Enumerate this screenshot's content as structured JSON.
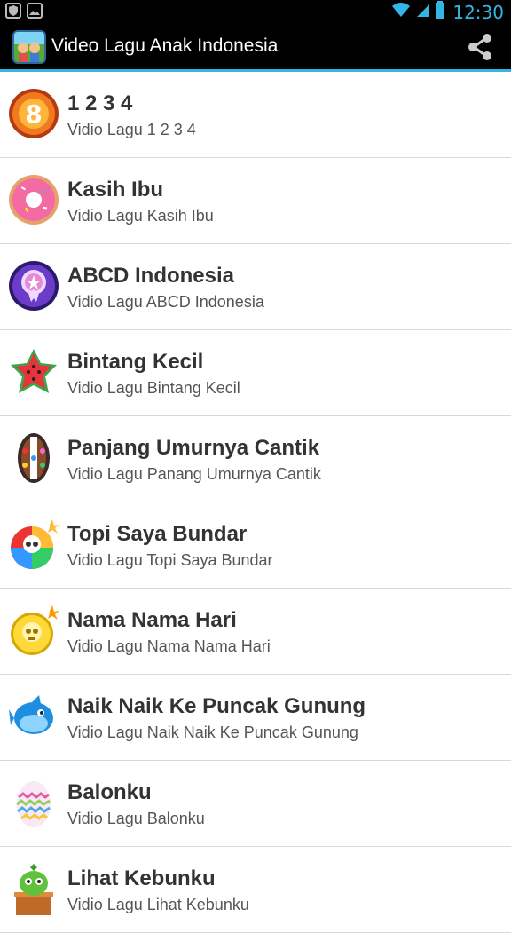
{
  "status_bar": {
    "time": "12:30",
    "icons": [
      "shield-icon",
      "image-icon",
      "wifi-icon",
      "signal-icon",
      "battery-icon"
    ]
  },
  "action_bar": {
    "title": "Video Lagu Anak Indonesia",
    "share_icon": "share-icon"
  },
  "items": [
    {
      "title": "1 2 3 4",
      "subtitle": "Vidio Lagu 1 2 3 4",
      "icon": "orange-number-8-icon"
    },
    {
      "title": "Kasih Ibu",
      "subtitle": "Vidio Lagu Kasih Ibu",
      "icon": "pink-donut-icon"
    },
    {
      "title": "ABCD Indonesia",
      "subtitle": "Vidio Lagu ABCD Indonesia",
      "icon": "purple-star-badge-icon"
    },
    {
      "title": "Bintang Kecil",
      "subtitle": "Vidio Lagu Bintang Kecil",
      "icon": "red-star-candy-icon"
    },
    {
      "title": "Panjang Umurnya Cantik",
      "subtitle": "Vidio Lagu Panang Umurnya Cantik",
      "icon": "striped-candy-icon"
    },
    {
      "title": "Topi Saya Bundar",
      "subtitle": "Vidio Lagu Topi Saya Bundar",
      "icon": "rainbow-skull-bomb-icon"
    },
    {
      "title": "Nama Nama Hari",
      "subtitle": "Vidio Lagu Nama Nama Hari",
      "icon": "yellow-skull-bomb-icon"
    },
    {
      "title": "Naik Naik Ke Puncak Gunung",
      "subtitle": "Vidio Lagu Naik Naik Ke Puncak Gunung",
      "icon": "blue-fish-icon"
    },
    {
      "title": "Balonku",
      "subtitle": "Vidio Lagu Balonku",
      "icon": "striped-egg-icon"
    },
    {
      "title": "Lihat Kebunku",
      "subtitle": "Vidio Lagu Lihat Kebunku",
      "icon": "green-plant-pot-icon"
    }
  ]
}
